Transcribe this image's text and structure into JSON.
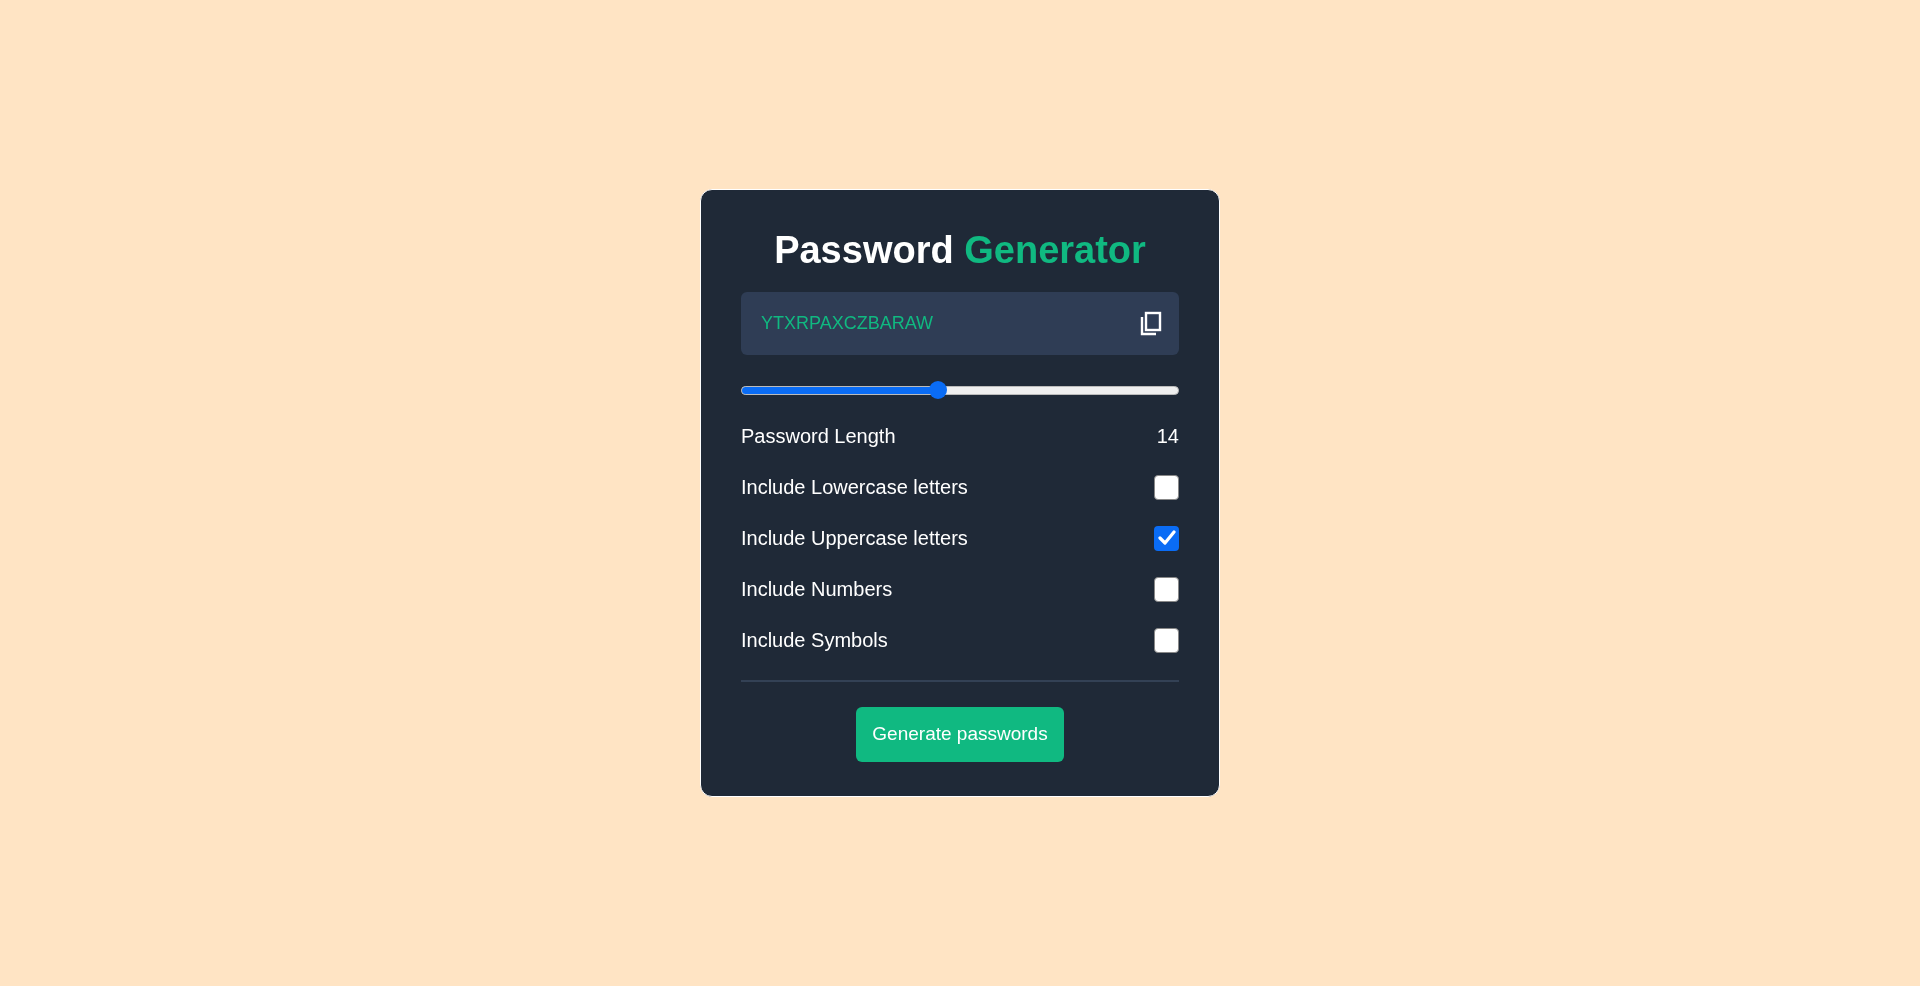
{
  "title": {
    "text": "Password",
    "accent": "Generator"
  },
  "password_field": {
    "value": "YTXRPAXCZBARAW"
  },
  "length_slider": {
    "level": 0.45
  },
  "length": {
    "label": "Password Length",
    "value": "14"
  },
  "options": [
    {
      "label": "Include Lowercase letters",
      "checked": false
    },
    {
      "label": "Include Uppercase letters",
      "checked": true
    },
    {
      "label": "Include Numbers",
      "checked": false
    },
    {
      "label": "Include Symbols",
      "checked": false
    }
  ],
  "generate_button": {
    "label": "Generate passwords"
  }
}
